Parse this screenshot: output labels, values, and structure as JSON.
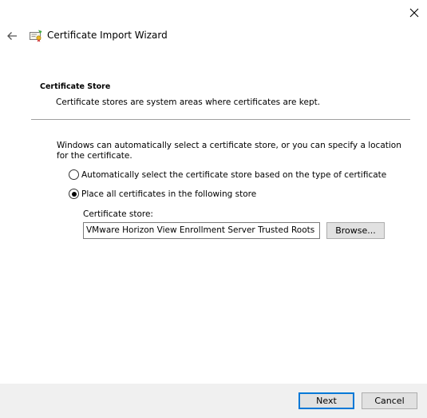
{
  "window": {
    "title": "Certificate Import Wizard",
    "close_icon": "close-icon",
    "back_icon": "back-arrow-icon",
    "title_icon": "certificate-icon"
  },
  "section": {
    "title": "Certificate Store",
    "description": "Certificate stores are system areas where certificates are kept."
  },
  "body": {
    "intro": "Windows can automatically select a certificate store, or you can specify a location for the certificate.",
    "options": [
      {
        "label": "Automatically select the certificate store based on the type of certificate",
        "checked": false
      },
      {
        "label": "Place all certificates in the following store",
        "checked": true
      }
    ],
    "store_label": "Certificate store:",
    "store_value": "VMware Horizon View Enrollment Server Trusted Roots",
    "browse_label": "Browse..."
  },
  "footer": {
    "next_label": "Next",
    "cancel_label": "Cancel"
  },
  "colors": {
    "accent": "#0078d7",
    "footer_bg": "#f0f0f0",
    "button_bg": "#e1e1e1"
  }
}
